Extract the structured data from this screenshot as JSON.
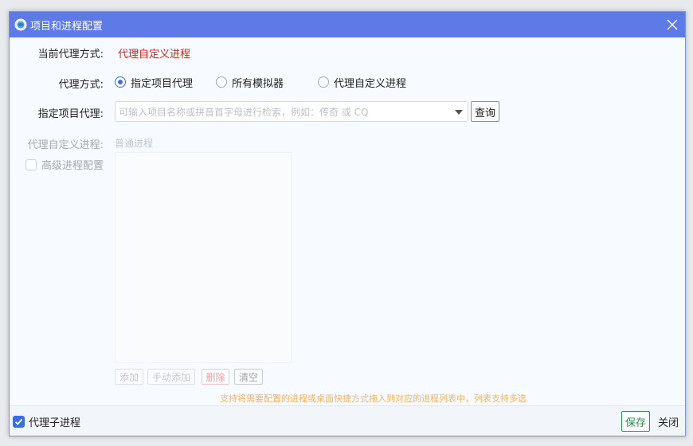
{
  "window": {
    "title": "项目和进程配置"
  },
  "current_mode": {
    "label": "当前代理方式:",
    "value": "代理自定义进程",
    "value_color": "#e0211a"
  },
  "proxy_mode": {
    "label": "代理方式:",
    "options": [
      {
        "label": "指定项目代理",
        "selected": true
      },
      {
        "label": "所有模拟器",
        "selected": false
      },
      {
        "label": "代理自定义进程",
        "selected": false
      }
    ]
  },
  "project_proxy": {
    "label": "指定项目代理:",
    "value": "",
    "placeholder": "可输入项目名称或拼音首字母进行检索，例如：传奇 或 CQ",
    "query_button": "查询"
  },
  "custom_process": {
    "label": "代理自定义进程:",
    "value": "普通进程",
    "advanced_label": "高级进程配置",
    "advanced_checked": false,
    "buttons": {
      "add": "添加",
      "manual_add": "手动添加",
      "delete": "删除",
      "clear": "清空"
    },
    "hint": "支持将需要配置的进程或桌面快捷方式拖入到对应的进程列表中，列表支持多选"
  },
  "footer": {
    "proxy_child_label": "代理子进程",
    "proxy_child_checked": true,
    "save": "保存",
    "close": "关闭"
  },
  "colors": {
    "titlebar": "#5d7ae7",
    "accent": "#3b6fe0",
    "save_green": "#2e8f4b",
    "hint_orange": "#f5b362"
  },
  "icons": {
    "app": "app-globe-icon",
    "close": "close-icon",
    "dropdown": "chevron-down-icon",
    "check": "checkmark-icon"
  }
}
